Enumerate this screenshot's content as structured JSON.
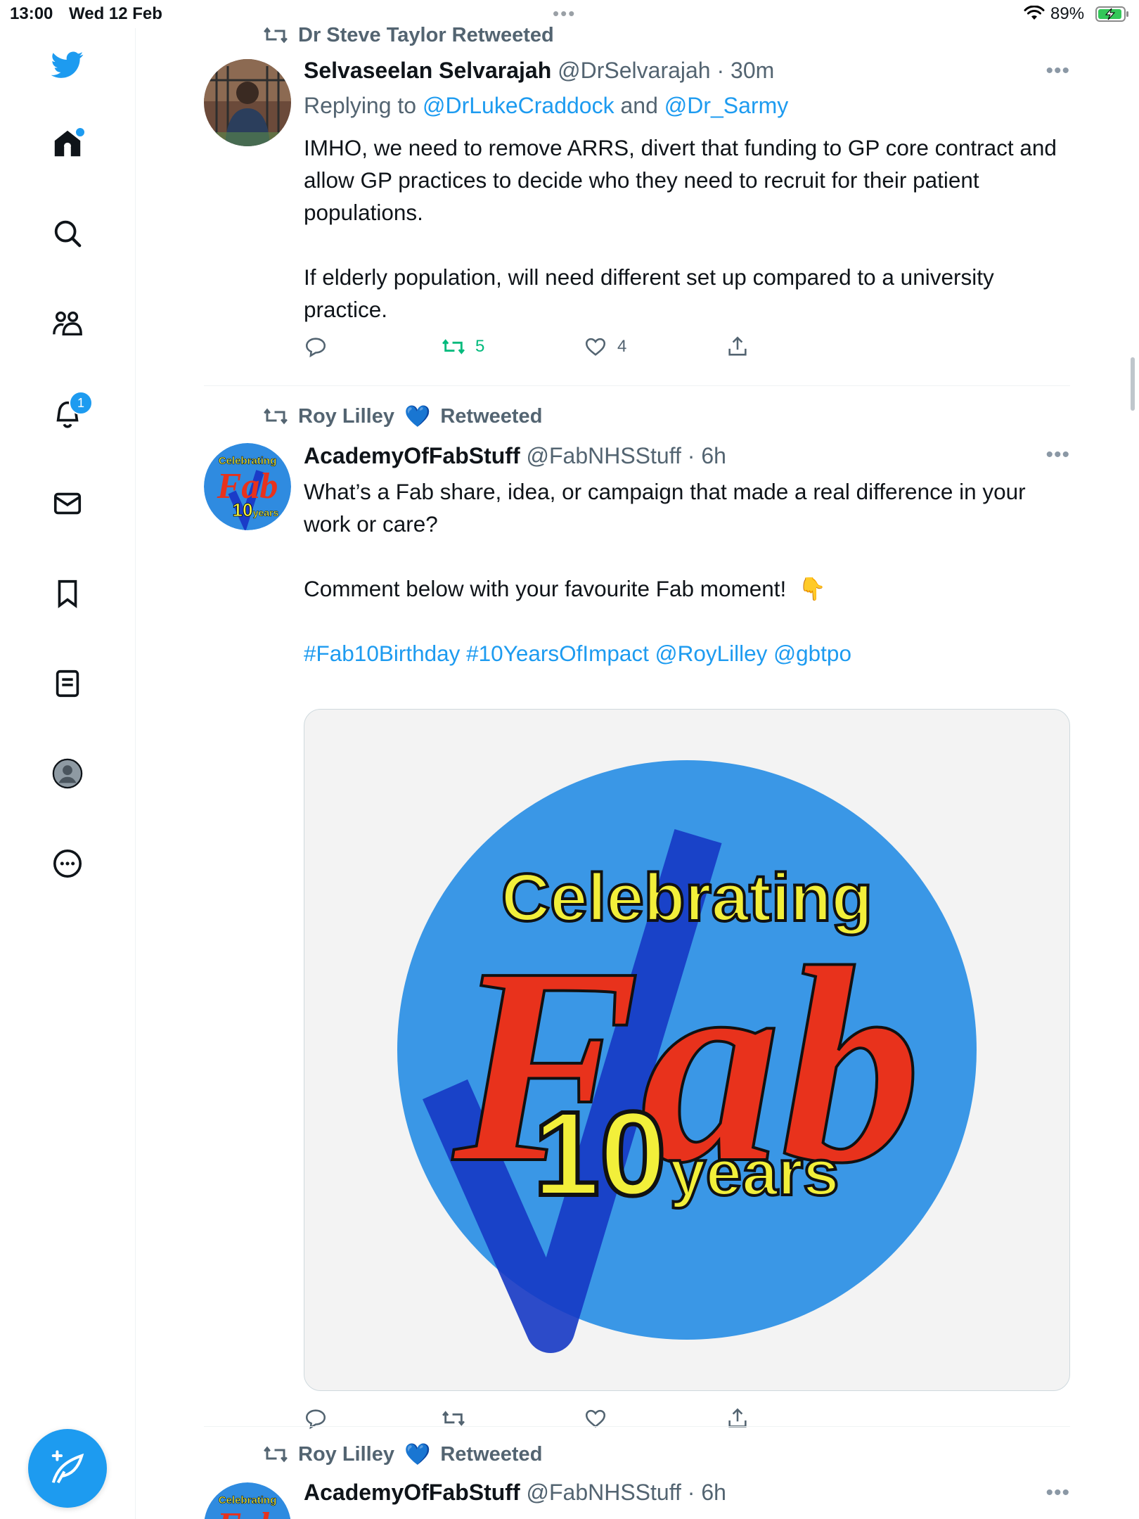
{
  "status_bar": {
    "time": "13:00",
    "date": "Wed 12 Feb",
    "battery_percent": "89%",
    "icons": [
      "wifi-icon",
      "battery-charging-icon"
    ]
  },
  "sidebar": {
    "items": [
      {
        "name": "twitter-logo-icon"
      },
      {
        "name": "home-icon",
        "has_dot": true
      },
      {
        "name": "search-icon"
      },
      {
        "name": "communities-icon"
      },
      {
        "name": "notifications-icon",
        "badge": "1"
      },
      {
        "name": "messages-icon"
      },
      {
        "name": "bookmarks-icon"
      },
      {
        "name": "lists-icon"
      },
      {
        "name": "profile-icon"
      },
      {
        "name": "more-icon"
      }
    ],
    "compose": {
      "name": "compose-tweet-icon"
    }
  },
  "tweets": [
    {
      "retweeted_by": "Dr Steve Taylor Retweeted",
      "display_name": "Selvaseelan Selvarajah",
      "handle": "@DrSelvarajah",
      "time": "30m",
      "replying_prefix": "Replying to ",
      "replying_mention_1": "@DrLukeCraddock",
      "replying_and": " and ",
      "replying_mention_2": "@Dr_Sarmy",
      "paragraph_1": "IMHO, we need to remove ARRS, divert that funding to GP core contract and allow GP practices to decide who they need to recruit for their patient populations.",
      "paragraph_2": "If elderly population, will need different set up compared to a university practice.",
      "replies": "",
      "retweets": "5",
      "likes": "4",
      "retweet_color": "#00ba7c"
    },
    {
      "retweeted_by_name": "Roy Lilley",
      "retweeted_by_suffix": "Retweeted",
      "display_name": "AcademyOfFabStuff",
      "handle": "@FabNHSStuff",
      "time": "6h",
      "paragraph_1": "What’s a Fab share, idea, or campaign that made a real difference in your work or care?",
      "paragraph_2": "Comment below with your favourite Fab moment!",
      "emoji": "👇",
      "hashtags": "#Fab10Birthday #10YearsOfImpact @RoyLilley @gbtpo",
      "image": {
        "top_text": "Celebrating",
        "main_text": "Fab",
        "number": "10",
        "sub_text": "years",
        "circle_color": "#3a97e6",
        "fab_color": "#e8321c",
        "yellow": "#f2ef3a"
      }
    },
    {
      "retweeted_by_name": "Roy Lilley",
      "retweeted_by_suffix": "Retweeted",
      "display_name": "AcademyOfFabStuff",
      "handle": "@FabNHSStuff",
      "time": "6h"
    }
  ],
  "accent": "#1d9bf0",
  "heart": "💙"
}
